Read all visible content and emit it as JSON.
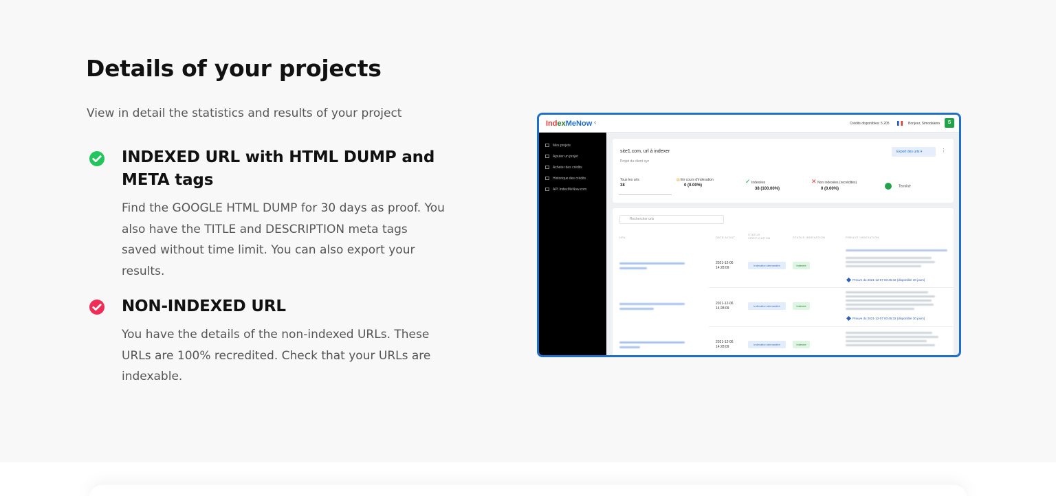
{
  "section": {
    "title": "Details of your projects",
    "subtitle": "View in detail the statistics and results of your project"
  },
  "features": [
    {
      "icon": "check-circle-icon",
      "icon_color": "#22c55e",
      "title": "INDEXED URL with HTML DUMP and META tags",
      "text": "Find the GOOGLE HTML DUMP for 30 days as proof. You also have the TITLE and DESCRIPTION meta tags saved without time limit. You can also export your results."
    },
    {
      "icon": "check-circle-icon",
      "icon_color": "#ef2d56",
      "title": "NON-INDEXED URL",
      "text": "You have the details of the non-indexed URLs. These URLs are 100% recredited. Check that your URLs are indexable."
    }
  ],
  "mockup": {
    "logo": {
      "part1": "Ind",
      "part2": "ex",
      "part3": "MeNow"
    },
    "collapse_icon": "chevron-left-icon",
    "credits": "Crédits disponibles: 5 205",
    "greeting": "Bonjour, Simodaleno",
    "avatar": "S",
    "sidebar": [
      "Mes projets",
      "Ajouter un projet",
      "Acheter des crédits",
      "Historique des crédits",
      "API IndexMeNow.com"
    ],
    "project_title": "site1.com, url à indexer",
    "project_subtitle": "Projet du client xyz",
    "export_label": "Export des urls",
    "stats": [
      {
        "label": "Tous les urls",
        "value": "38"
      },
      {
        "label": "En cours d'indexation",
        "value": "0 (0.00%)"
      },
      {
        "label": "Indexées",
        "value": "38 (100.00%)"
      },
      {
        "label": "Non indexées (recrédités)",
        "value": "0 (0.00%)"
      },
      {
        "label": "Terminé",
        "value": ""
      }
    ],
    "search_placeholder": "Rechercher urls",
    "columns": [
      "URL",
      "DATE AJOUT",
      "STATUS VÉRIFICATION",
      "STATUS INDEXATION",
      "PREUVE INDEXATION"
    ],
    "rows": [
      {
        "date": "2021-12-06 14:28:09",
        "verification": "Indexation demandée",
        "indexation": "Indexée",
        "proof": "Preuve du 2021-12-07 00:45:32 (disponible 30 jours)"
      },
      {
        "date": "2021-12-06 14:28:09",
        "verification": "Indexation demandée",
        "indexation": "Indexée",
        "proof": "Preuve du 2021-12-07 00:45:32 (disponible 30 jours)"
      },
      {
        "date": "2021-12-06 14:28:09",
        "verification": "Indexation demandée",
        "indexation": "Indexée",
        "proof": ""
      }
    ],
    "colors": {
      "frame": "#1e6fc9",
      "sidebar": "#000000",
      "accent_green": "#22a34a"
    }
  }
}
